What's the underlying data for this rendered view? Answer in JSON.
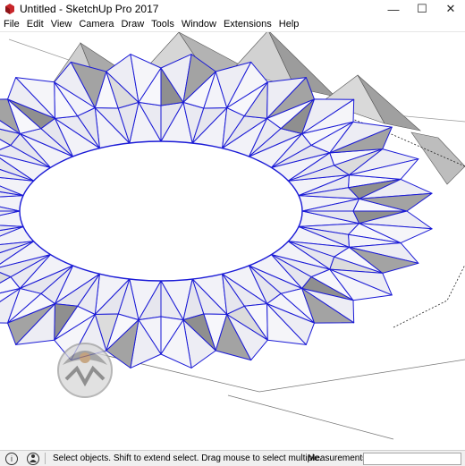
{
  "window": {
    "title": "Untitled - SketchUp Pro 2017",
    "controls": {
      "minimize": "—",
      "maximize": "☐",
      "close": "✕"
    }
  },
  "menubar": {
    "items": [
      "File",
      "Edit",
      "View",
      "Camera",
      "Draw",
      "Tools",
      "Window",
      "Extensions",
      "Help"
    ]
  },
  "statusbar": {
    "info_icon": "i",
    "user_icon": "person-icon",
    "message": "Select objects. Shift to extend select. Drag mouse to select multiple.",
    "measurements_label": "Measurements",
    "measurements_value": ""
  },
  "colors": {
    "edge_selected": "#1a1ad6",
    "face_fill": "#f2f2f8",
    "shadow_face": "#9a9a9a"
  }
}
